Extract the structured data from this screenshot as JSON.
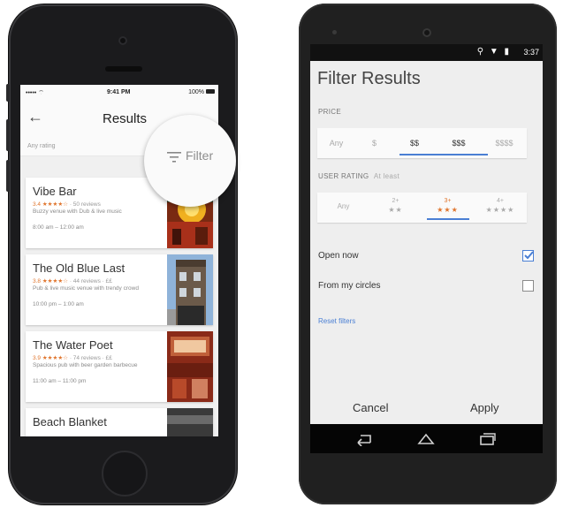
{
  "colors": {
    "accent_blue": "#4a7fd4",
    "star_orange": "#e0752d",
    "phone_body": "#1b1b1d"
  },
  "ios": {
    "status": {
      "carrier": "••••• ⌔",
      "time": "9:41 PM",
      "battery": "100%"
    },
    "header": {
      "back_icon": "arrow-left-icon",
      "title": "Results"
    },
    "subbar": {
      "text": "Any rating"
    },
    "filter": {
      "icon": "filter-icon",
      "label": "Filter"
    },
    "places": [
      {
        "name": "Vibe Bar",
        "score": "3.4",
        "stars": "★★★★☆",
        "meta": "· 50 reviews",
        "desc": "Buzzy venue with Dub & live music",
        "hours": "8:00 am – 12:00 am",
        "image": "bar-interior-photo"
      },
      {
        "name": "The Old Blue Last",
        "score": "3.8",
        "stars": "★★★★☆",
        "meta": "· 44 reviews · ££",
        "desc": "Pub & live music venue with trendy crowd",
        "hours": "10:00 pm – 1:00 am",
        "image": "pub-building-photo"
      },
      {
        "name": "The Water Poet",
        "score": "3.9",
        "stars": "★★★★☆",
        "meta": "· 74 reviews · ££",
        "desc": "Spacious pub with beer garden barbecue",
        "hours": "11:00 am – 11:00 pm",
        "image": "pub-interior-photo"
      },
      {
        "name": "Beach Blanket",
        "score": "",
        "stars": "",
        "meta": "",
        "desc": "",
        "hours": "",
        "image": "restaurant-photo"
      }
    ]
  },
  "android": {
    "status": {
      "time": "3:37",
      "icons": "⚲ ▼ ▮"
    },
    "title": "Filter Results",
    "price": {
      "label": "PRICE",
      "options": [
        "Any",
        "$",
        "$$",
        "$$$",
        "$$$$"
      ],
      "selected": [
        "$$",
        "$$$"
      ]
    },
    "rating": {
      "label": "USER RATING",
      "sublabel": "At least",
      "options": [
        {
          "label": "Any",
          "stars": ""
        },
        {
          "label": "2+",
          "stars": "★★"
        },
        {
          "label": "3+",
          "stars": "★★★"
        },
        {
          "label": "4+",
          "stars": "★★★★"
        }
      ],
      "selected": "3+"
    },
    "open_now": {
      "label": "Open now",
      "checked": true
    },
    "from_circles": {
      "label": "From my circles",
      "checked": false
    },
    "reset": "Reset filters",
    "actions": {
      "cancel": "Cancel",
      "apply": "Apply"
    },
    "nav": [
      "back-icon",
      "home-icon",
      "recents-icon"
    ]
  }
}
